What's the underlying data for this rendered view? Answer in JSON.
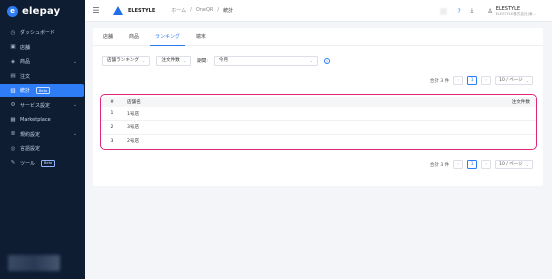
{
  "app": {
    "logo_text": "elepay",
    "logo_mark": "e"
  },
  "sidebar": {
    "items": [
      {
        "label": "ダッシュボード",
        "icon": "dashboard-icon",
        "glyph": "◷",
        "active": false,
        "caret": false
      },
      {
        "label": "店舗",
        "icon": "store-icon",
        "glyph": "▣",
        "active": false,
        "caret": false
      },
      {
        "label": "商品",
        "icon": "product-icon",
        "glyph": "◈",
        "active": false,
        "caret": true
      },
      {
        "label": "注文",
        "icon": "order-icon",
        "glyph": "▤",
        "active": false,
        "caret": false
      },
      {
        "label": "統計",
        "icon": "chart-icon",
        "glyph": "▥",
        "active": true,
        "caret": false,
        "badge": "Beta"
      },
      {
        "label": "サービス設定",
        "icon": "settings-icon",
        "glyph": "⚙",
        "active": false,
        "caret": true
      },
      {
        "label": "Marketplace",
        "icon": "marketplace-icon",
        "glyph": "▦",
        "active": false,
        "caret": false
      },
      {
        "label": "規約設定",
        "icon": "terms-icon",
        "glyph": "≣",
        "active": false,
        "caret": true
      },
      {
        "label": "言語設定",
        "icon": "language-icon",
        "glyph": "◎",
        "active": false,
        "caret": false
      },
      {
        "label": "ツール",
        "icon": "tool-icon",
        "glyph": "✎",
        "active": false,
        "caret": false,
        "badge": "Beta"
      }
    ],
    "caret_glyph": "⌄"
  },
  "topbar": {
    "menu_glyph": "☰",
    "brand_name": "ELESTYLE",
    "breadcrumb": [
      "ホーム",
      "/",
      "OneQR",
      "/",
      "統計"
    ],
    "help_glyph": "?",
    "download_glyph": "⤓",
    "user_glyph": "♙",
    "user_name": "ELESTYLE",
    "user_sub": "ELESTYLE株式会社(東..."
  },
  "tabs": [
    "店舗",
    "商品",
    "ランキング",
    "端末"
  ],
  "active_tab": 2,
  "filters": {
    "ranking_type": "店舗ランキング",
    "sort": "注文件数",
    "period_label": "期間:",
    "period_value": "今月",
    "help": "?",
    "arrow": "⌄"
  },
  "pager": {
    "total": "合計 3 件",
    "prev": "‹",
    "next": "›",
    "page": "1",
    "size": "10 / ページ",
    "arrow": "⌄"
  },
  "table": {
    "headers": {
      "num": "#",
      "name": "店舗名",
      "count": "注文件数"
    },
    "rows": [
      {
        "num": "1",
        "name": "1号店",
        "count": ""
      },
      {
        "num": "2",
        "name": "3号店",
        "count": ""
      },
      {
        "num": "3",
        "name": "2号店",
        "count": ""
      }
    ]
  },
  "colors": {
    "accent": "#2f7df6",
    "sidebar_bg": "#0f1d33",
    "highlight": "#e0267a"
  }
}
